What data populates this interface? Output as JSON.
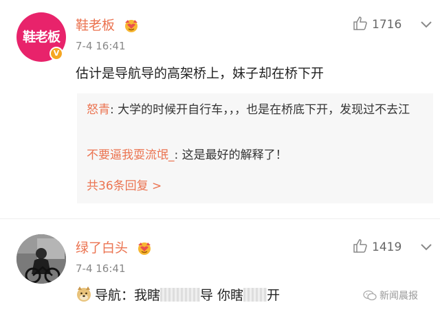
{
  "comments": [
    {
      "avatar_text": "鞋老板",
      "badge": "V",
      "username": "鞋老板",
      "time": "7-4 16:41",
      "likes": "1716",
      "content": "估计是导航导的高架桥上，妹子却在桥下开",
      "replies": [
        {
          "name": "怒青",
          "text": ": 大学的时候开自行车，，，也是在桥底下开，发现过不去江"
        },
        {
          "name": "不要逼我耍流氓_",
          "text": ": 这是最好的解释了！"
        }
      ],
      "more_replies": "共36条回复 >"
    },
    {
      "username": "绿了白头",
      "time": "7-4 16:41",
      "likes": "1419",
      "content_parts": [
        "导航：我瞎",
        "导 你瞎",
        "开"
      ]
    }
  ],
  "watermark": "新闻晨报",
  "colors": {
    "username": "#eb7350",
    "avatar_bg": "#e8236b",
    "reply_bg": "#f7f7f7"
  }
}
